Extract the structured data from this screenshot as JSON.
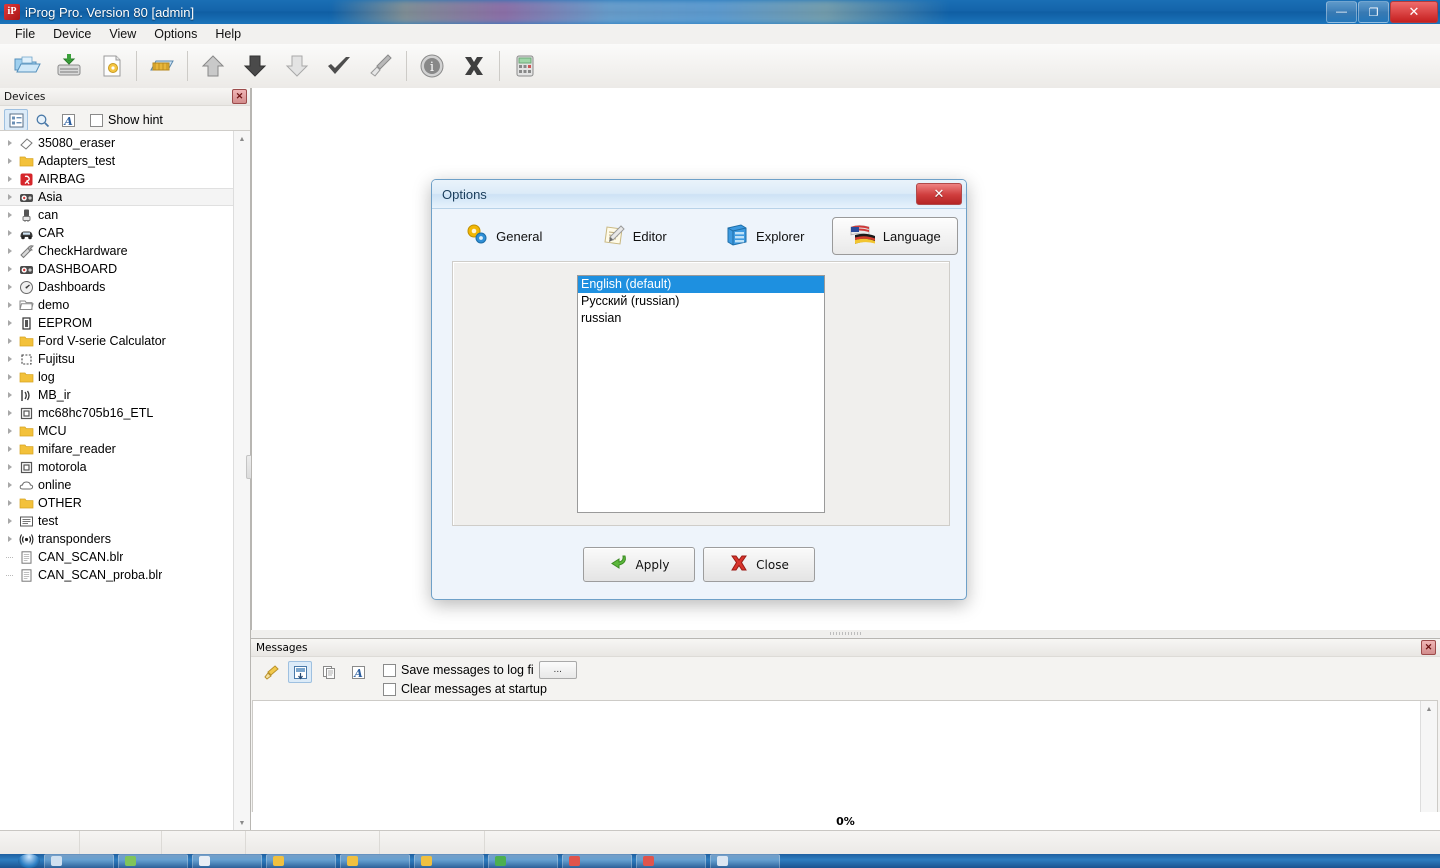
{
  "window": {
    "title": "iProg Pro. Version 80 [admin]",
    "icon": "iprog-app-icon",
    "controls": {
      "minimize": "—",
      "restore": "❐",
      "close": "✕"
    }
  },
  "menu": {
    "items": [
      "File",
      "Device",
      "View",
      "Options",
      "Help"
    ]
  },
  "toolbar": {
    "items": [
      {
        "name": "open-folder-icon",
        "title": "Open"
      },
      {
        "name": "save-to-disk-icon",
        "title": "Save"
      },
      {
        "name": "new-document-icon",
        "title": "New"
      },
      {
        "sep": true
      },
      {
        "name": "chip-hardware-icon",
        "title": "Hardware"
      },
      {
        "sep": true
      },
      {
        "name": "arrow-up-icon",
        "title": "Read"
      },
      {
        "name": "arrow-down-dark-icon",
        "title": "Write"
      },
      {
        "name": "arrow-down-light-icon",
        "title": "Verify"
      },
      {
        "name": "checkmark-icon",
        "title": "Check"
      },
      {
        "name": "brush-icon",
        "title": "Erase"
      },
      {
        "sep": true
      },
      {
        "name": "info-icon",
        "title": "Info"
      },
      {
        "name": "cancel-x-icon",
        "title": "Cancel"
      },
      {
        "sep": true
      },
      {
        "name": "calculator-icon",
        "title": "Calculator"
      }
    ]
  },
  "devices": {
    "title": "Devices",
    "close_label": "✕",
    "tools": [
      {
        "name": "tree-view-icon",
        "pressed": true
      },
      {
        "name": "search-icon",
        "pressed": false
      },
      {
        "name": "font-icon",
        "pressed": false
      }
    ],
    "show_hint_label": "Show hint",
    "show_hint_checked": false,
    "tree": [
      {
        "label": "35080_eraser",
        "icon": "eraser-icon",
        "leaf": false,
        "selected": false
      },
      {
        "label": "Adapters_test",
        "icon": "folder-icon",
        "leaf": false,
        "selected": false
      },
      {
        "label": "AIRBAG",
        "icon": "airbag-icon",
        "leaf": false,
        "selected": false
      },
      {
        "label": "Asia",
        "icon": "dashboard-icon",
        "leaf": false,
        "selected": true
      },
      {
        "label": "can",
        "icon": "can-icon",
        "leaf": false,
        "selected": false
      },
      {
        "label": "CAR",
        "icon": "car-icon",
        "leaf": false,
        "selected": false
      },
      {
        "label": "CheckHardware",
        "icon": "wrench-icon",
        "leaf": false,
        "selected": false
      },
      {
        "label": "DASHBOARD",
        "icon": "dashboard-icon",
        "leaf": false,
        "selected": false
      },
      {
        "label": "Dashboards",
        "icon": "gauge-icon",
        "leaf": false,
        "selected": false
      },
      {
        "label": "demo",
        "icon": "folder-open-icon",
        "leaf": false,
        "selected": false
      },
      {
        "label": "EEPROM",
        "icon": "eeprom-icon",
        "leaf": false,
        "selected": false
      },
      {
        "label": "Ford V-serie Calculator",
        "icon": "folder-icon",
        "leaf": false,
        "selected": false
      },
      {
        "label": "Fujitsu",
        "icon": "chip-icon",
        "leaf": false,
        "selected": false
      },
      {
        "label": "log",
        "icon": "folder-icon",
        "leaf": false,
        "selected": false
      },
      {
        "label": "MB_ir",
        "icon": "ir-icon",
        "leaf": false,
        "selected": false
      },
      {
        "label": "mc68hc705b16_ETL",
        "icon": "mcu-icon",
        "leaf": false,
        "selected": false
      },
      {
        "label": "MCU",
        "icon": "folder-icon",
        "leaf": false,
        "selected": false
      },
      {
        "label": "mifare_reader",
        "icon": "folder-icon",
        "leaf": false,
        "selected": false
      },
      {
        "label": "motorola",
        "icon": "mcu-icon",
        "leaf": false,
        "selected": false
      },
      {
        "label": "online",
        "icon": "cloud-icon",
        "leaf": false,
        "selected": false
      },
      {
        "label": "OTHER",
        "icon": "folder-icon",
        "leaf": false,
        "selected": false
      },
      {
        "label": "test",
        "icon": "list-icon",
        "leaf": false,
        "selected": false
      },
      {
        "label": "transponders",
        "icon": "rfid-icon",
        "leaf": false,
        "selected": false
      },
      {
        "label": "CAN_SCAN.blr",
        "icon": "file-icon",
        "leaf": true,
        "selected": false
      },
      {
        "label": "CAN_SCAN_proba.blr",
        "icon": "file-icon",
        "leaf": true,
        "selected": false
      }
    ]
  },
  "messages": {
    "title": "Messages",
    "close_label": "✕",
    "tools": [
      {
        "name": "brush-clear-icon"
      },
      {
        "name": "save-messages-icon"
      },
      {
        "name": "copy-messages-icon"
      },
      {
        "name": "font-messages-icon"
      }
    ],
    "options": [
      {
        "label": "Save messages to log fi",
        "checked": false,
        "has_browse": true,
        "browse_label": "..."
      },
      {
        "label": "Clear messages at startup",
        "checked": false,
        "has_browse": false
      }
    ],
    "content": ""
  },
  "status": {
    "progress_label": "0%"
  },
  "dialog": {
    "title": "Options",
    "close_label": "✕",
    "tabs": [
      {
        "label": "General",
        "icon": "gears-icon",
        "active": false
      },
      {
        "label": "Editor",
        "icon": "notepad-pen-icon",
        "active": false
      },
      {
        "label": "Explorer",
        "icon": "cabinet-icon",
        "active": false
      },
      {
        "label": "Language",
        "icon": "flags-icon",
        "active": true
      }
    ],
    "language_list": [
      {
        "label": "English (default)",
        "selected": true
      },
      {
        "label": "Русский (russian)",
        "selected": false
      },
      {
        "label": "russian",
        "selected": false
      }
    ],
    "buttons": [
      {
        "label": "Apply",
        "icon": "green-arrow-icon"
      },
      {
        "label": "Close",
        "icon": "red-x-icon"
      }
    ]
  },
  "colors": {
    "title_bar": "#1464aa",
    "selection": "#1e90e0",
    "close_red": "#cf3d3d",
    "folder_yellow": "#f0c040"
  }
}
